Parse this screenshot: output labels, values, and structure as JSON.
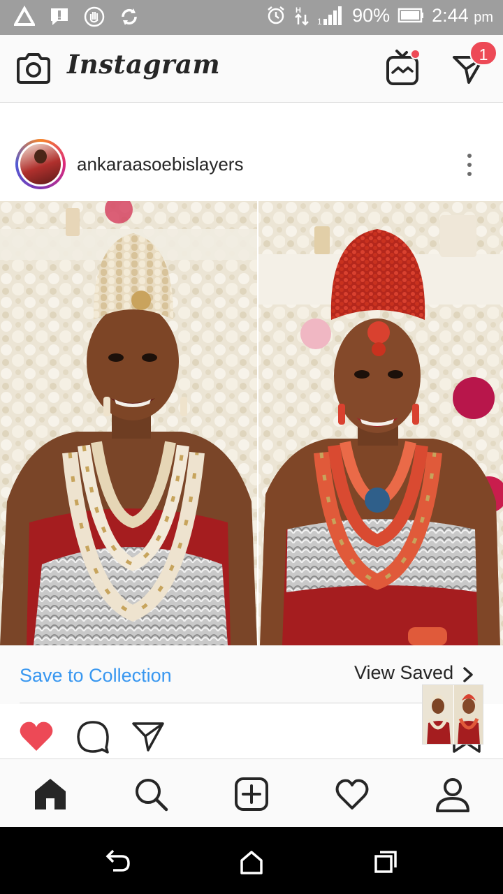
{
  "status_bar": {
    "battery": "90%",
    "time": "2:44",
    "time_suffix": "pm",
    "left_icons": [
      "warning-icon",
      "message-alert-icon",
      "hand-stop-icon",
      "sync-icon"
    ],
    "right_icons": [
      "alarm-icon",
      "data-arrows-icon",
      "signal-icon",
      "battery-icon"
    ]
  },
  "header": {
    "app_title": "Instagram",
    "notification_badge": "1",
    "icons": [
      "camera-icon",
      "igtv-icon",
      "direct-message-icon"
    ]
  },
  "post": {
    "username": "ankaraasoebislayers",
    "menu_icon": "more-vertical-icon"
  },
  "collection_bar": {
    "save_label": "Save to Collection",
    "view_saved_label": "View Saved"
  },
  "actions": {
    "liked": true,
    "icons": [
      "heart-filled-icon",
      "comment-icon",
      "share-icon"
    ]
  },
  "bottom_nav": {
    "items": [
      "home-icon",
      "search-icon",
      "new-post-icon",
      "activity-heart-icon",
      "profile-icon"
    ],
    "active": "home"
  },
  "system_nav": [
    "back-icon",
    "home-icon",
    "recents-icon"
  ],
  "colors": {
    "accent_blue": "#3897f0",
    "like_red": "#ed4956",
    "status_bar_gray": "#9e9e9e",
    "text_dark": "#262626"
  }
}
